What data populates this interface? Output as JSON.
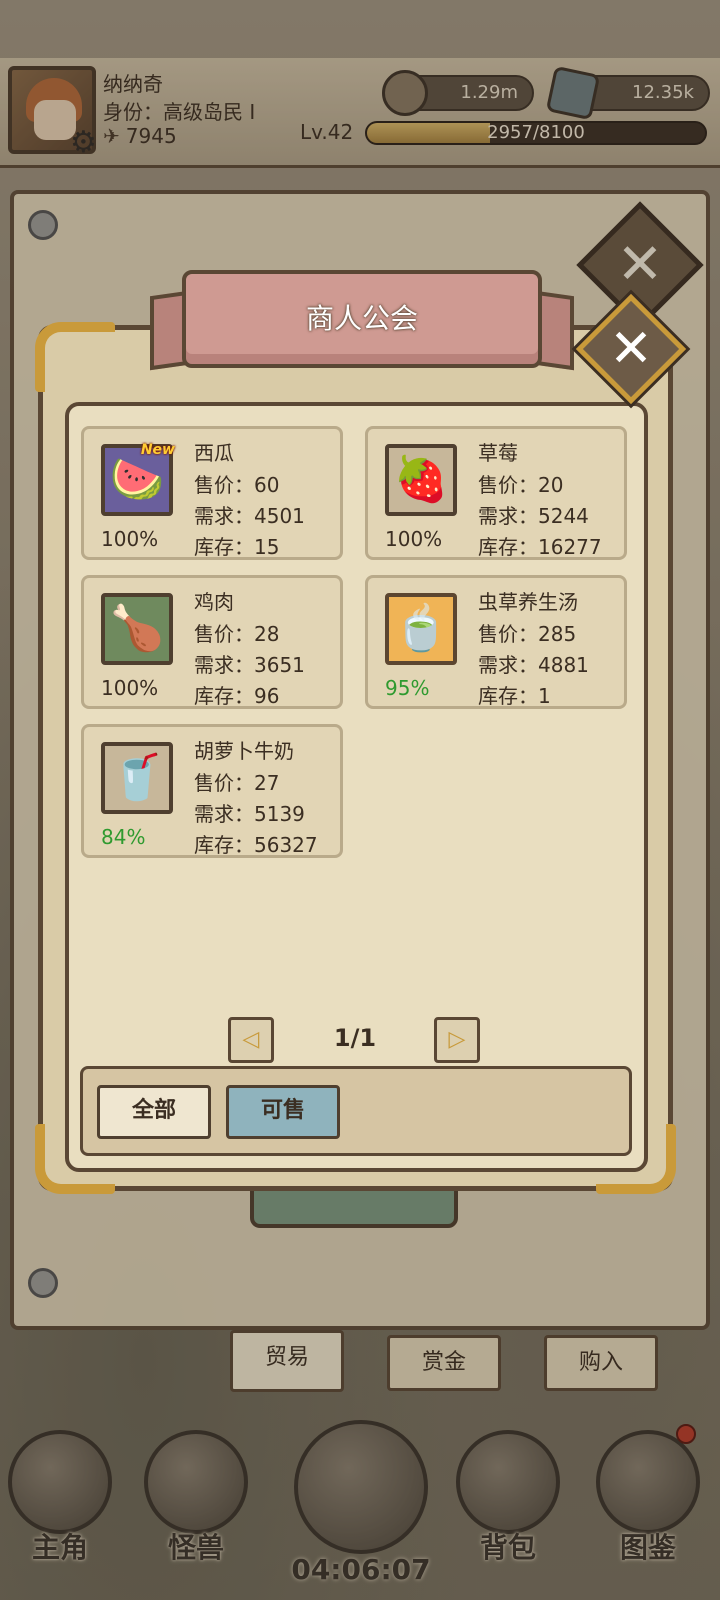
{
  "player": {
    "name": "纳纳奇",
    "title": "身份：高级岛民 Ⅰ",
    "power": "7945",
    "level": "Lv.42",
    "xp_text": "2957/8100",
    "xp_fraction": 0.365
  },
  "resources": {
    "coins": "1.29m",
    "gems": "12.35k"
  },
  "dialog": {
    "title": "商人公会",
    "close_symbol": "✕",
    "items": [
      {
        "name": "西瓜",
        "price": "售价：60",
        "demand": "需求：4501",
        "stock": "库存：15",
        "percent": "100%",
        "is_new": true,
        "new_label": "New",
        "icon": "watermelon-icon",
        "icon_glyph": "🍉"
      },
      {
        "name": "草莓",
        "price": "售价：20",
        "demand": "需求：5244",
        "stock": "库存：16277",
        "percent": "100%",
        "is_new": false,
        "icon": "strawberry-icon",
        "icon_glyph": "🍓"
      },
      {
        "name": "鸡肉",
        "price": "售价：28",
        "demand": "需求：3651",
        "stock": "库存：96",
        "percent": "100%",
        "is_new": false,
        "icon": "chicken-leg-icon",
        "icon_glyph": "🍗"
      },
      {
        "name": "虫草养生汤",
        "price": "售价：285",
        "demand": "需求：4881",
        "stock": "库存：1",
        "percent": "95%",
        "is_new": false,
        "icon": "soup-cup-icon",
        "icon_glyph": "🍵"
      },
      {
        "name": "胡萝卜牛奶",
        "price": "售价：27",
        "demand": "需求：5139",
        "stock": "库存：56327",
        "percent": "84%",
        "is_new": false,
        "icon": "carrot-milk-icon",
        "icon_glyph": "🥤"
      }
    ],
    "pagination": {
      "text": "1/1",
      "prev_symbol": "◁",
      "next_symbol": "▷"
    },
    "filters": {
      "all": "全部",
      "sellable": "可售"
    }
  },
  "sub_tabs": {
    "trade": "贸易",
    "bounty": "赏金",
    "buy": "购入"
  },
  "bottom_nav": {
    "hero": "主角",
    "monster": "怪兽",
    "timer": "04:06:07",
    "bag": "背包",
    "codex": "图鉴"
  },
  "colors": {
    "accent_gold": "#c99a3a",
    "frame_brown": "#5a4734",
    "ribbon_pink": "#cf9a92",
    "percent_green": "#2f9a2f",
    "sell_filter_blue": "#8fb3bd"
  }
}
